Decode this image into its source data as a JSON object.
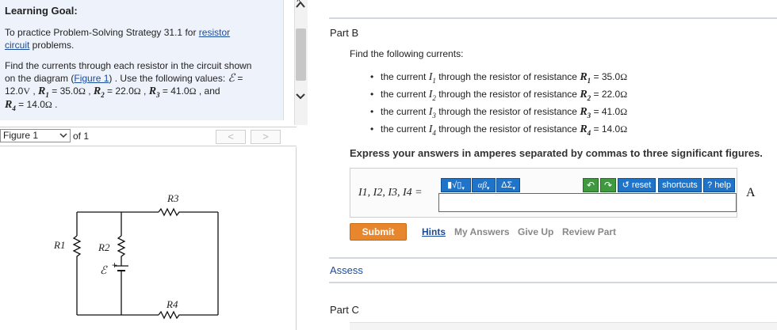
{
  "left_panel": {
    "heading": "Learning Goal:",
    "goal_prefix": "To practice Problem-Solving Strategy 31.1 for ",
    "goal_link1": "resistor",
    "goal_link2": "circuit",
    "goal_suffix": " problems.",
    "find_line1": "Find the currents through each resistor in the circuit shown",
    "find_line2_pre": "on the diagram (",
    "find_figure_link": "Figure 1",
    "find_line2_post": ") . Use the following values:",
    "values": {
      "emf_symbol": "ℰ",
      "emf_value": "12.0",
      "emf_unit": "V",
      "r1_value": "35.0",
      "r2_value": "22.0",
      "r3_value": "41.0",
      "r4_value": "14.0",
      "ohm": "Ω"
    }
  },
  "figure_bar": {
    "select_value": "Figure 1",
    "of_text": "of 1",
    "prev_label": "<",
    "next_label": ">"
  },
  "circuit": {
    "labels": {
      "r1": "R1",
      "r2": "R2",
      "r3": "R3",
      "r4": "R4",
      "emf": "ℰ",
      "plus": "+"
    }
  },
  "part_b": {
    "title": "Part B",
    "find_text": "Find the following currents:",
    "bullets": [
      {
        "pre": "the current ",
        "current": "I",
        "sub": "1",
        "mid": " through the resistor of resistance ",
        "res": "R",
        "rsub": "1",
        "value": " = 35.0"
      },
      {
        "pre": "the current ",
        "current": "I",
        "sub": "2",
        "mid": " through the resistor of resistance ",
        "res": "R",
        "rsub": "2",
        "value": " = 22.0"
      },
      {
        "pre": "the current ",
        "current": "I",
        "sub": "3",
        "mid": " through the resistor of resistance ",
        "res": "R",
        "rsub": "3",
        "value": " = 41.0"
      },
      {
        "pre": "the current ",
        "current": "I",
        "sub": "4",
        "mid": " through the resistor of resistance ",
        "res": "R",
        "rsub": "4",
        "value": " = 14.0"
      }
    ],
    "ohm": "Ω",
    "instruction": "Express your answers in amperes separated by commas to three significant figures.",
    "toolbar": {
      "templates": "▮√▯",
      "greek": "αβ",
      "symbols": "ΔΣ",
      "undo": "↶",
      "redo": "↷",
      "reset": "reset",
      "shortcuts": "shortcuts",
      "help": "help",
      "help_q": "?"
    },
    "answer_label": "I1, I2, I3, I4 =",
    "answer_value": "",
    "unit": "A",
    "submit": "Submit",
    "links": {
      "hints": "Hints",
      "my_answers": "My Answers",
      "give_up": "Give Up",
      "review_part": "Review Part"
    }
  },
  "assess": "Assess",
  "part_c": {
    "title": "Part C"
  },
  "colors": {
    "panel_bg": "#eef3fb",
    "link": "#1a4a9c",
    "toolbar_blue": "#1f73c8",
    "toolbar_green": "#3f9a3f",
    "submit_orange": "#e8862e",
    "rule": "#d3d7df"
  }
}
